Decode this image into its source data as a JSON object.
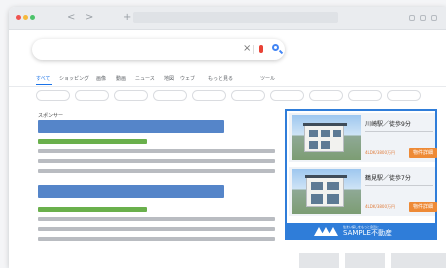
{
  "browser": {
    "back_icon": "chevron-left-icon",
    "forward_icon": "chevron-right-icon",
    "new_tab_icon": "plus-icon",
    "back": "<",
    "forward": ">",
    "new_tab": "+"
  },
  "search": {
    "value": "",
    "clear": "×",
    "icons": [
      "clear-icon",
      "mic-icon",
      "search-icon"
    ]
  },
  "tabs": [
    {
      "label": "すべて",
      "active": true
    },
    {
      "label": "ショッピング"
    },
    {
      "label": "画像"
    },
    {
      "label": "動画"
    },
    {
      "label": "ニュース"
    },
    {
      "label": "地図"
    },
    {
      "label": "ウェブ"
    },
    {
      "label": "もっと見る"
    },
    {
      "label": "ツール"
    }
  ],
  "sponsored_label": "スポンサー",
  "ad": {
    "listings": [
      {
        "station": "川崎駅／徒歩9分",
        "price": "4LDK/3800万円",
        "button": "物件詳細"
      },
      {
        "station": "鶴見駅／徒歩7分",
        "price": "4LDK/3800万円",
        "button": "物件詳細"
      }
    ],
    "tagline": "住まい探しをもっと身近に",
    "company": "SAMPLE不動産"
  },
  "colors": {
    "accent": "#2f7dd9",
    "result_title": "#5585c9",
    "result_url": "#6ab04c",
    "button": "#ee8a36"
  }
}
